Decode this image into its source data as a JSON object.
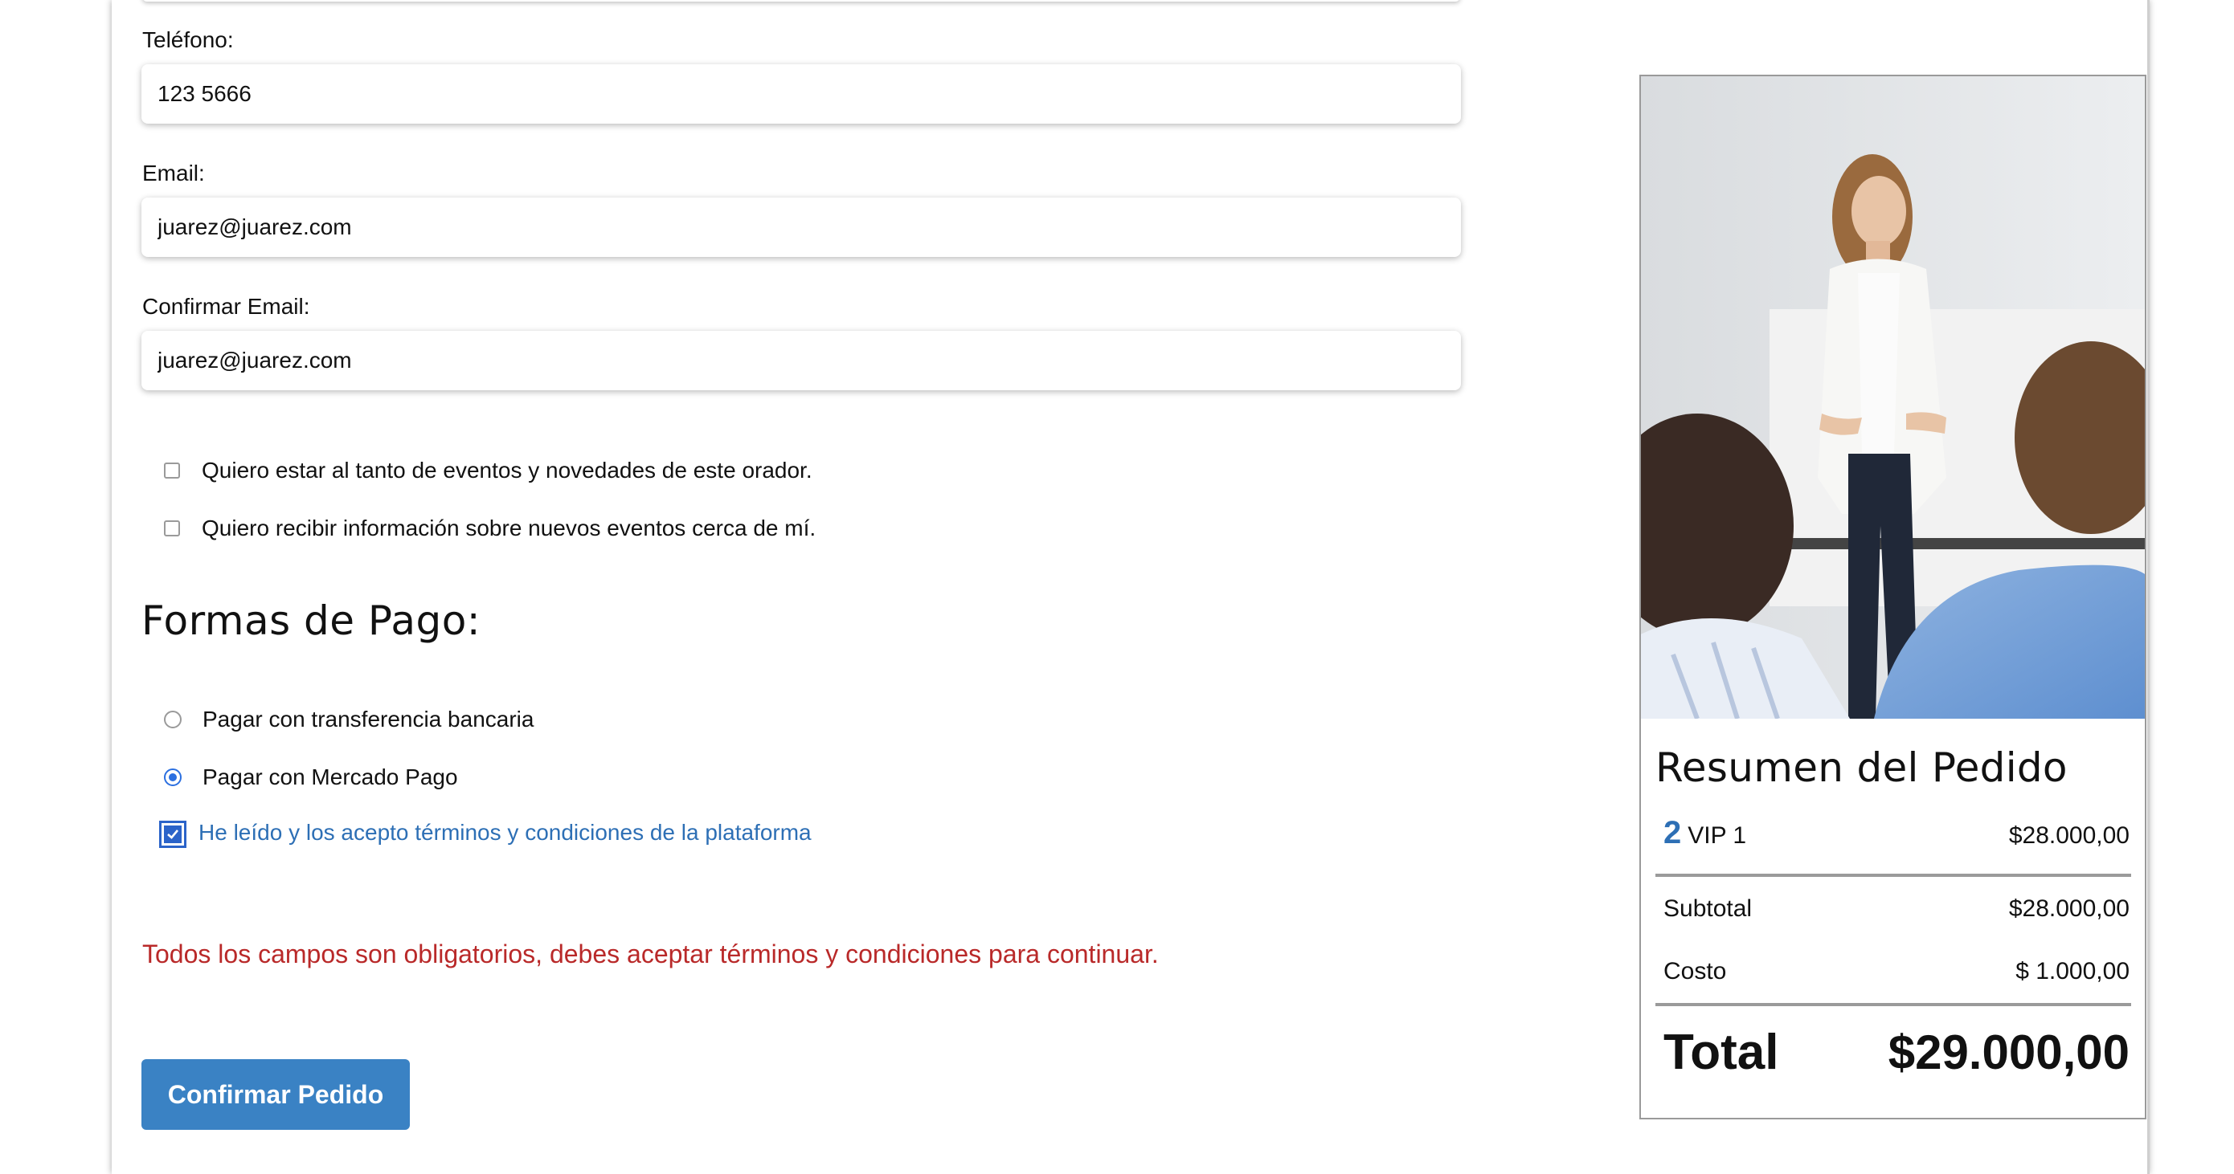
{
  "form": {
    "phone": {
      "label": "Teléfono:",
      "value": "123 5666"
    },
    "email": {
      "label": "Email:",
      "value": "juarez@juarez.com"
    },
    "confirm_email": {
      "label": "Confirmar Email:",
      "value": "juarez@juarez.com"
    },
    "opt_in_1": "Quiero estar al tanto de eventos y novedades de este orador.",
    "opt_in_2": "Quiero recibir información sobre nuevos eventos cerca de mí."
  },
  "payment": {
    "title": "Formas de Pago:",
    "options": [
      {
        "label": "Pagar con transferencia bancaria",
        "selected": false
      },
      {
        "label": "Pagar con Mercado Pago",
        "selected": true
      }
    ],
    "terms_label": "He leído y los acepto términos y condiciones de la plataforma",
    "terms_checked": true
  },
  "error_message": "Todos los campos son obligatorios, debes aceptar términos y condiciones para continuar.",
  "confirm_button": "Confirmar Pedido",
  "summary": {
    "title": "Resumen del Pedido",
    "item": {
      "qty": "2",
      "name": "VIP 1",
      "price": "$28.000,00"
    },
    "subtotal": {
      "label": "Subtotal",
      "value": "$28.000,00"
    },
    "cost": {
      "label": "Costo",
      "value": "$ 1.000,00"
    },
    "total": {
      "label": "Total",
      "value": "$29.000,00"
    }
  },
  "colors": {
    "accent": "#3a82c4",
    "link": "#2d6fb5",
    "error": "#b92929",
    "radio_selected": "#2b6fe0"
  }
}
